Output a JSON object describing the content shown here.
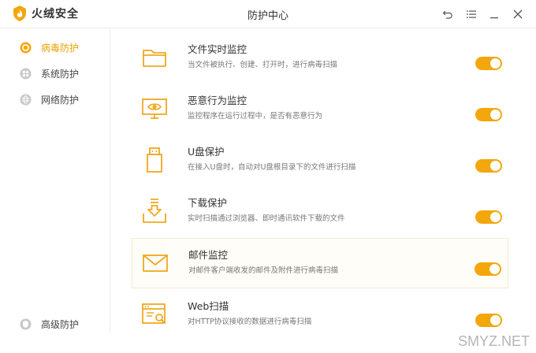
{
  "app": {
    "logo_text": "火绒安全",
    "window_title": "防护中心",
    "accent_color": "#f3a70d",
    "controls": [
      "back-icon",
      "menu-icon",
      "minimize-icon",
      "close-icon"
    ]
  },
  "sidebar": {
    "items": [
      {
        "label": "病毒防护",
        "icon": "virus-shield-icon",
        "active": true
      },
      {
        "label": "系统防护",
        "icon": "system-shield-icon",
        "active": false
      },
      {
        "label": "网络防护",
        "icon": "globe-icon",
        "active": false
      }
    ],
    "bottom_item": {
      "label": "高级防护",
      "icon": "advanced-shield-icon"
    }
  },
  "protections": [
    {
      "title": "文件实时监控",
      "desc": "当文件被执行、创建、打开时，进行病毒扫描",
      "icon": "folder-icon",
      "enabled": true
    },
    {
      "title": "恶意行为监控",
      "desc": "监控程序在运行过程中，是否有恶意行为",
      "icon": "monitor-eye-icon",
      "enabled": true
    },
    {
      "title": "U盘保护",
      "desc": "在接入U盘时，自动对U盘根目录下的文件进行扫描",
      "icon": "usb-drive-icon",
      "enabled": true
    },
    {
      "title": "下载保护",
      "desc": "实时扫描通过浏览器、即时通讯软件下载的文件",
      "icon": "download-tray-icon",
      "enabled": true
    },
    {
      "title": "邮件监控",
      "desc": "对邮件客户端收发的邮件及附件进行病毒扫描",
      "icon": "mail-icon",
      "enabled": true
    },
    {
      "title": "Web扫描",
      "desc": "对HTTP协议接收的数据进行病毒扫描",
      "icon": "web-scan-icon",
      "enabled": true
    }
  ],
  "watermark": "SMYZ.NET"
}
